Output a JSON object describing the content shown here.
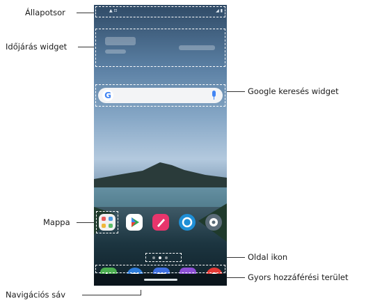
{
  "labels": {
    "status_bar": "Állapotsor",
    "weather_widget": "Időjárás widget",
    "folder": "Mappa",
    "navigation_bar": "Navigációs sáv",
    "google_search_widget": "Google keresés widget",
    "page_icon": "Oldal ikon",
    "quick_access_area": "Gyors hozzáférési terület"
  },
  "search_widget": {
    "logo": "G",
    "mic_icon": "mic-icon"
  },
  "home_apps": [
    {
      "name": "folder-icon",
      "color": "#f1f1f1"
    },
    {
      "name": "play-store-icon",
      "color": "#ffffff"
    },
    {
      "name": "quickmemo-icon",
      "color": "#e8356c"
    },
    {
      "name": "smartworld-icon",
      "color": "#1f8fd6"
    },
    {
      "name": "settings-icon",
      "color": "#5a6b78"
    }
  ],
  "dock_apps": [
    {
      "name": "phone-icon",
      "color": "#4caf50"
    },
    {
      "name": "messages-icon",
      "color": "#2e7ddb"
    },
    {
      "name": "camera-icon",
      "color": "#3d6ee0"
    },
    {
      "name": "gallery-icon",
      "color": "#8e4fd6"
    },
    {
      "name": "chrome-icon",
      "color": "#e53935"
    }
  ],
  "colors": {
    "dashed_outline": "#ffffff",
    "leader_line": "#333333"
  }
}
